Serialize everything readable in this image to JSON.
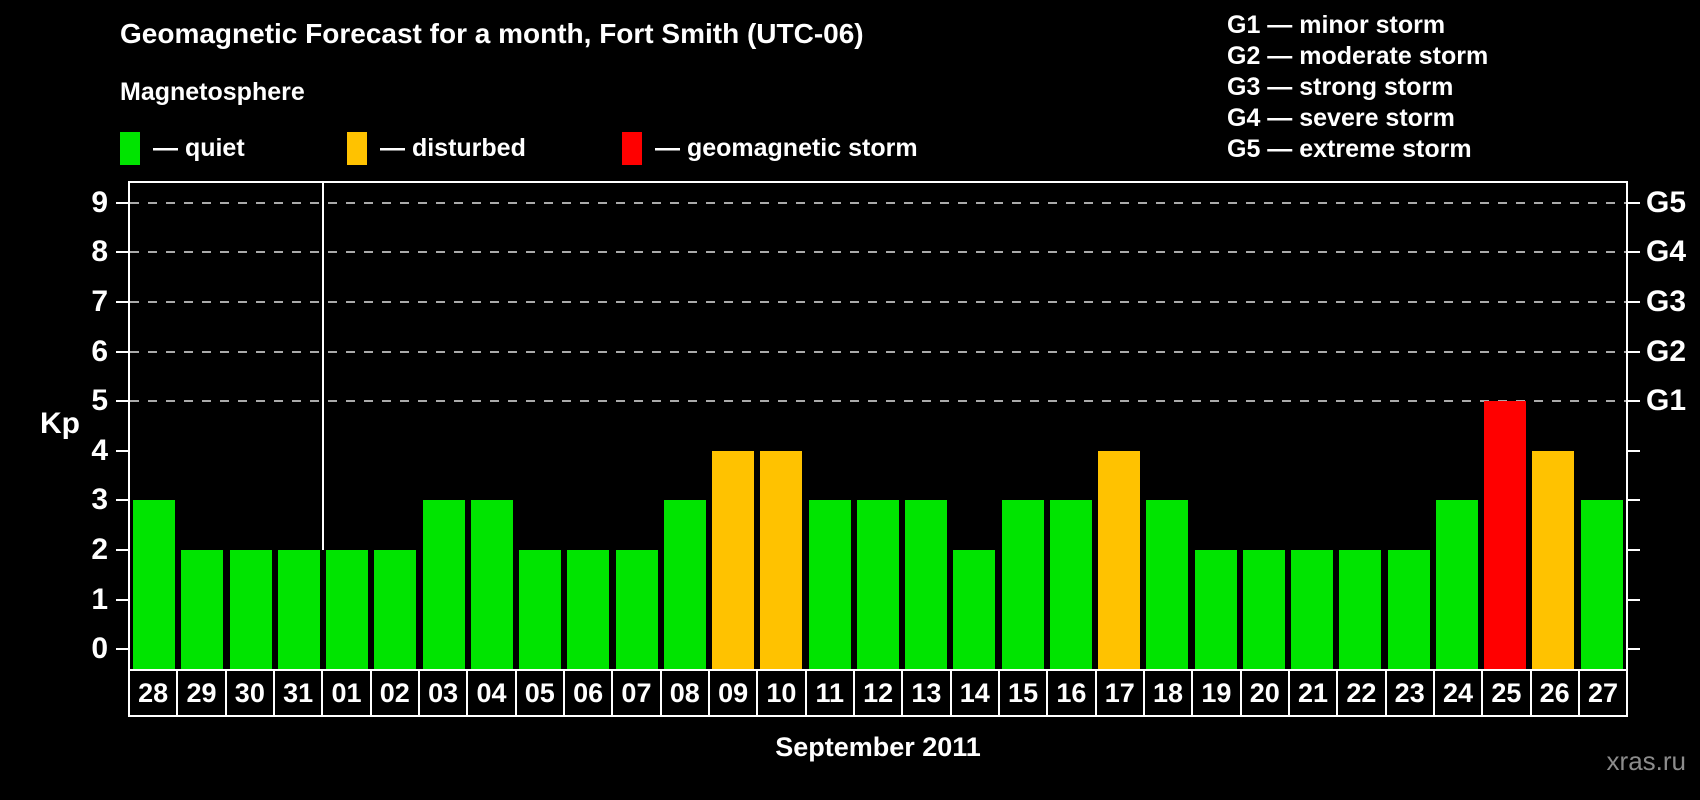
{
  "header": {
    "title": "Geomagnetic Forecast for a month, Fort Smith (UTC-06)",
    "subtitle": "Magnetosphere"
  },
  "magnetosphere_legend": [
    {
      "status": "quiet",
      "label": "— quiet",
      "color": "#00e400"
    },
    {
      "status": "disturbed",
      "label": "— disturbed",
      "color": "#ffc200"
    },
    {
      "status": "storm",
      "label": "— geomagnetic storm",
      "color": "#ff0000"
    }
  ],
  "storm_scale_legend": [
    "G1 — minor storm",
    "G2 — moderate storm",
    "G3 — strong storm",
    "G4 — severe storm",
    "G5 — extreme storm"
  ],
  "chart_data": {
    "type": "bar",
    "title": "Geomagnetic Forecast for a month, Fort Smith (UTC-06)",
    "xlabel": "September 2011",
    "ylabel": "Kp",
    "ylim": [
      -0.4,
      9.4
    ],
    "yticks": [
      0,
      1,
      2,
      3,
      4,
      5,
      6,
      7,
      8,
      9
    ],
    "gridlines_at": [
      5,
      6,
      7,
      8,
      9
    ],
    "grid": "dashed",
    "right_axis": [
      {
        "kp": 5,
        "label": "G1"
      },
      {
        "kp": 6,
        "label": "G2"
      },
      {
        "kp": 7,
        "label": "G3"
      },
      {
        "kp": 8,
        "label": "G4"
      },
      {
        "kp": 9,
        "label": "G5"
      }
    ],
    "month_separator_after": "31",
    "categories": [
      "28",
      "29",
      "30",
      "31",
      "01",
      "02",
      "03",
      "04",
      "05",
      "06",
      "07",
      "08",
      "09",
      "10",
      "11",
      "12",
      "13",
      "14",
      "15",
      "16",
      "17",
      "18",
      "19",
      "20",
      "21",
      "22",
      "23",
      "24",
      "25",
      "26",
      "27"
    ],
    "values": [
      3,
      2,
      2,
      2,
      2,
      2,
      3,
      3,
      2,
      2,
      2,
      3,
      4,
      4,
      3,
      3,
      3,
      2,
      3,
      3,
      4,
      3,
      2,
      2,
      2,
      2,
      2,
      3,
      5,
      4,
      3
    ],
    "statuses": [
      "quiet",
      "quiet",
      "quiet",
      "quiet",
      "quiet",
      "quiet",
      "quiet",
      "quiet",
      "quiet",
      "quiet",
      "quiet",
      "quiet",
      "disturbed",
      "disturbed",
      "quiet",
      "quiet",
      "quiet",
      "quiet",
      "quiet",
      "quiet",
      "disturbed",
      "quiet",
      "quiet",
      "quiet",
      "quiet",
      "quiet",
      "quiet",
      "quiet",
      "storm",
      "disturbed",
      "quiet"
    ]
  },
  "colors": {
    "quiet": "#00e400",
    "disturbed": "#ffc200",
    "storm": "#ff0000",
    "grid": "#aaaaaa",
    "axis": "#ffffff"
  },
  "watermark": "xras.ru"
}
